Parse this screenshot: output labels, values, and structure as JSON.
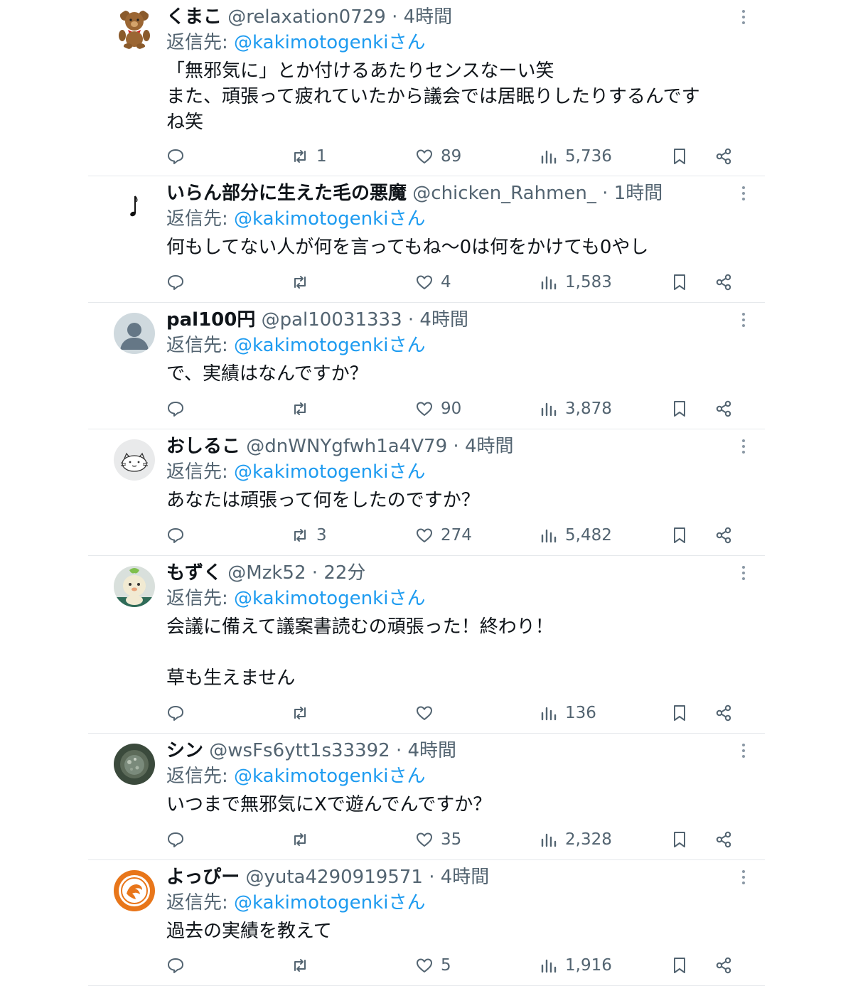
{
  "tweets": [
    {
      "name": "くまこ",
      "handle": "@relaxation0729",
      "time": "4時間",
      "reply_prefix": "返信先:",
      "reply_to": "@kakimotogenkiさん",
      "text": "「無邪気に」とか付けるあたりセンスなーい笑\nまた、頑張って疲れていたから議会では居眠りしたりするんです\nね笑",
      "replies": "",
      "retweets": "1",
      "likes": "89",
      "views": "5,736",
      "avatar": "teddy-bear"
    },
    {
      "name": "いらん部分に生えた毛の悪魔",
      "handle": "@chicken_Rahmen_",
      "time": "1時間",
      "reply_prefix": "返信先:",
      "reply_to": "@kakimotogenkiさん",
      "text": "何もしてない人が何を言ってもね〜0は何をかけても0やし",
      "replies": "",
      "retweets": "",
      "likes": "4",
      "views": "1,583",
      "avatar": "music-note"
    },
    {
      "name": "pal100円",
      "handle": "@pal10031333",
      "time": "4時間",
      "reply_prefix": "返信先:",
      "reply_to": "@kakimotogenkiさん",
      "text": "で、実績はなんですか？",
      "replies": "",
      "retweets": "",
      "likes": "90",
      "views": "3,878",
      "avatar": "default-person"
    },
    {
      "name": "おしるこ",
      "handle": "@dnWNYgfwh1a4V79",
      "time": "4時間",
      "reply_prefix": "返信先:",
      "reply_to": "@kakimotogenkiさん",
      "text": "あなたは頑張って何をしたのですか？",
      "replies": "",
      "retweets": "3",
      "likes": "274",
      "views": "5,482",
      "avatar": "cat-sketch"
    },
    {
      "name": "もずく",
      "handle": "@Mzk52",
      "time": "22分",
      "reply_prefix": "返信先:",
      "reply_to": "@kakimotogenkiさん",
      "text": "会議に備えて議案書読むの頑張った！終わり！\n\n草も生えません",
      "replies": "",
      "retweets": "",
      "likes": "",
      "views": "136",
      "avatar": "mascot-character"
    },
    {
      "name": "シン",
      "handle": "@wsFs6ytt1s33392",
      "time": "4時間",
      "reply_prefix": "返信先:",
      "reply_to": "@kakimotogenkiさん",
      "text": "いつまで無邪気にXで遊んでんですか？",
      "replies": "",
      "retweets": "",
      "likes": "35",
      "views": "2,328",
      "avatar": "dark-photo"
    },
    {
      "name": "よっぴー",
      "handle": "@yuta4290919571",
      "time": "4時間",
      "reply_prefix": "返信先:",
      "reply_to": "@kakimotogenkiさん",
      "text": "過去の実績を教えて",
      "replies": "",
      "retweets": "",
      "likes": "5",
      "views": "1,916",
      "avatar": "orange-emblem"
    }
  ],
  "separator": "·",
  "colors": {
    "text": "#0f1419",
    "secondary": "#536471",
    "link": "#1d9bf0",
    "divider": "#e6e9ec"
  }
}
